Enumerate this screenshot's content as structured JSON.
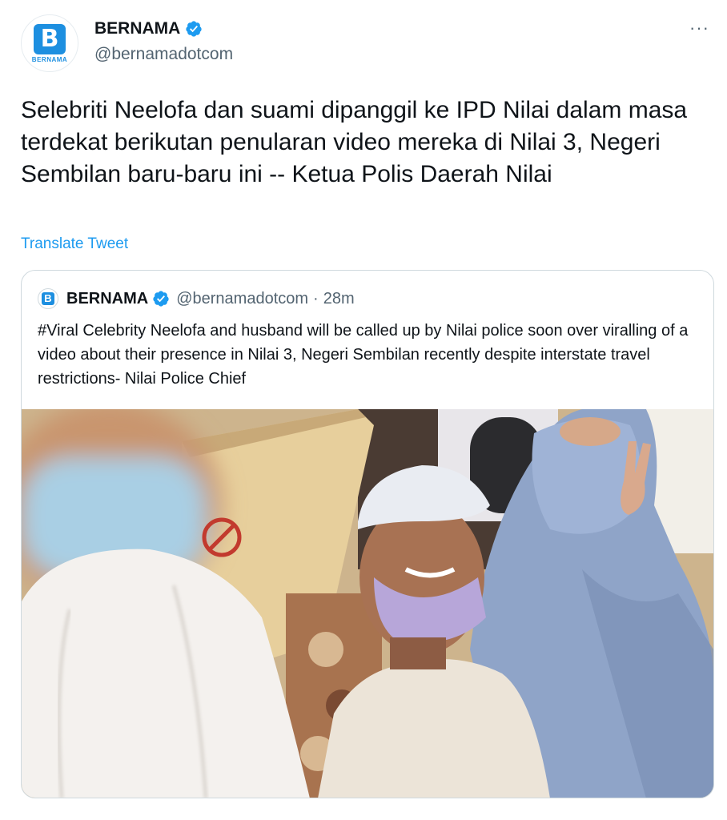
{
  "author": {
    "display_name": "BERNAMA",
    "handle": "@bernamadotcom",
    "avatar_label": "BERNAMA",
    "avatar_letter": "B"
  },
  "more_label": "···",
  "tweet_text": "Selebriti Neelofa dan suami dipanggil ke IPD Nilai dalam masa terdekat berikutan penularan video mereka di Nilai 3, Negeri Sembilan baru-baru ini -- Ketua Polis Daerah Nilai",
  "translate_label": "Translate Tweet",
  "quoted": {
    "display_name": "BERNAMA",
    "handle": "@bernamadotcom",
    "separator": "·",
    "time": "28m",
    "avatar_letter": "B",
    "text": "#Viral Celebrity Neelofa and husband will be called up by Nilai police soon over viralling of a video about their presence in Nilai 3, Negeri Sembilan recently despite interstate travel restrictions- Nilai Police Chief"
  },
  "colors": {
    "accent": "#1d9bf0",
    "brand": "#1d8fe0",
    "text": "#0f1419",
    "secondary": "#536471",
    "border": "#cfd9de"
  }
}
